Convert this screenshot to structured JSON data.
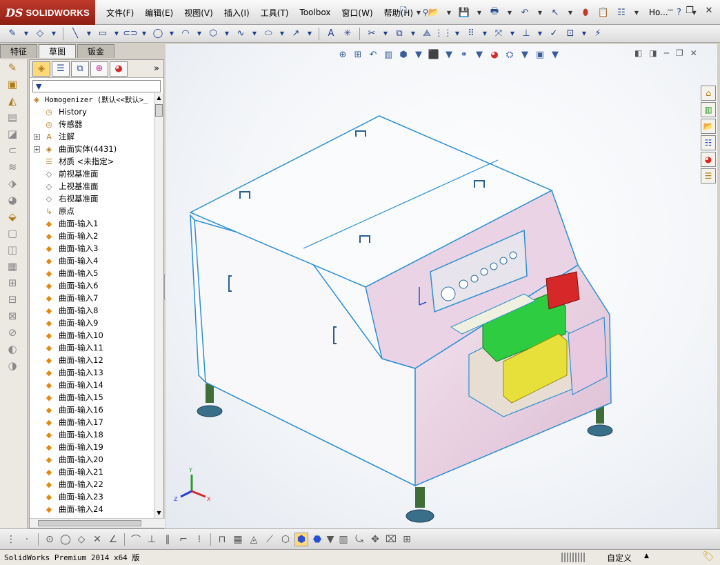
{
  "app": {
    "logo_ds": "DS",
    "logo_text": "SOLIDWORKS",
    "title_short": "Ho..."
  },
  "menu": [
    "文件(F)",
    "编辑(E)",
    "视图(V)",
    "插入(I)",
    "工具(T)",
    "Toolbox",
    "窗口(W)",
    "帮助(H)"
  ],
  "tabs": [
    "特征",
    "草图",
    "钣金"
  ],
  "active_tab": 1,
  "tree": {
    "root": "Homogenizer  (默认<<默认>_",
    "items": [
      {
        "label": "History",
        "icon": "history-icon",
        "glyph": "◷",
        "expandable": false
      },
      {
        "label": "传感器",
        "icon": "sensor-icon",
        "glyph": "◎",
        "expandable": false
      },
      {
        "label": "注解",
        "icon": "annotation-icon",
        "glyph": "A",
        "expandable": true
      },
      {
        "label": "曲面实体(4431)",
        "icon": "surface-bodies-icon",
        "glyph": "◈",
        "expandable": true
      },
      {
        "label": "材质 <未指定>",
        "icon": "material-icon",
        "glyph": "☰",
        "expandable": false
      },
      {
        "label": "前视基准面",
        "icon": "plane-icon",
        "glyph": "◇",
        "expandable": false
      },
      {
        "label": "上视基准面",
        "icon": "plane-icon",
        "glyph": "◇",
        "expandable": false
      },
      {
        "label": "右视基准面",
        "icon": "plane-icon",
        "glyph": "◇",
        "expandable": false
      },
      {
        "label": "原点",
        "icon": "origin-icon",
        "glyph": "↳",
        "expandable": false
      },
      {
        "label": "曲面-输入1",
        "icon": "surface-import-icon",
        "glyph": "◆",
        "expandable": false
      },
      {
        "label": "曲面-输入2",
        "icon": "surface-import-icon",
        "glyph": "◆",
        "expandable": false
      },
      {
        "label": "曲面-输入3",
        "icon": "surface-import-icon",
        "glyph": "◆",
        "expandable": false
      },
      {
        "label": "曲面-输入4",
        "icon": "surface-import-icon",
        "glyph": "◆",
        "expandable": false
      },
      {
        "label": "曲面-输入5",
        "icon": "surface-import-icon",
        "glyph": "◆",
        "expandable": false
      },
      {
        "label": "曲面-输入6",
        "icon": "surface-import-icon",
        "glyph": "◆",
        "expandable": false
      },
      {
        "label": "曲面-输入7",
        "icon": "surface-import-icon",
        "glyph": "◆",
        "expandable": false
      },
      {
        "label": "曲面-输入8",
        "icon": "surface-import-icon",
        "glyph": "◆",
        "expandable": false
      },
      {
        "label": "曲面-输入9",
        "icon": "surface-import-icon",
        "glyph": "◆",
        "expandable": false
      },
      {
        "label": "曲面-输入10",
        "icon": "surface-import-icon",
        "glyph": "◆",
        "expandable": false
      },
      {
        "label": "曲面-输入11",
        "icon": "surface-import-icon",
        "glyph": "◆",
        "expandable": false
      },
      {
        "label": "曲面-输入12",
        "icon": "surface-import-icon",
        "glyph": "◆",
        "expandable": false
      },
      {
        "label": "曲面-输入13",
        "icon": "surface-import-icon",
        "glyph": "◆",
        "expandable": false
      },
      {
        "label": "曲面-输入14",
        "icon": "surface-import-icon",
        "glyph": "◆",
        "expandable": false
      },
      {
        "label": "曲面-输入15",
        "icon": "surface-import-icon",
        "glyph": "◆",
        "expandable": false
      },
      {
        "label": "曲面-输入16",
        "icon": "surface-import-icon",
        "glyph": "◆",
        "expandable": false
      },
      {
        "label": "曲面-输入17",
        "icon": "surface-import-icon",
        "glyph": "◆",
        "expandable": false
      },
      {
        "label": "曲面-输入18",
        "icon": "surface-import-icon",
        "glyph": "◆",
        "expandable": false
      },
      {
        "label": "曲面-输入19",
        "icon": "surface-import-icon",
        "glyph": "◆",
        "expandable": false
      },
      {
        "label": "曲面-输入20",
        "icon": "surface-import-icon",
        "glyph": "◆",
        "expandable": false
      },
      {
        "label": "曲面-输入21",
        "icon": "surface-import-icon",
        "glyph": "◆",
        "expandable": false
      },
      {
        "label": "曲面-输入22",
        "icon": "surface-import-icon",
        "glyph": "◆",
        "expandable": false
      },
      {
        "label": "曲面-输入23",
        "icon": "surface-import-icon",
        "glyph": "◆",
        "expandable": false
      },
      {
        "label": "曲面-输入24",
        "icon": "surface-import-icon",
        "glyph": "◆",
        "expandable": false
      }
    ]
  },
  "triad": {
    "x": "X",
    "y": "Y",
    "z": "Z"
  },
  "status": {
    "text": "SolidWorks Premium 2014 x64 版",
    "units": "自定义"
  },
  "colors": {
    "accent": "#2a6fd1",
    "model_edge": "#2a8fd1",
    "panel_face": "#e6c7dc",
    "green_block": "#2ecc40",
    "red_block": "#d62828",
    "yellow_block": "#e8e03a",
    "foot": "#3a6f8a"
  }
}
